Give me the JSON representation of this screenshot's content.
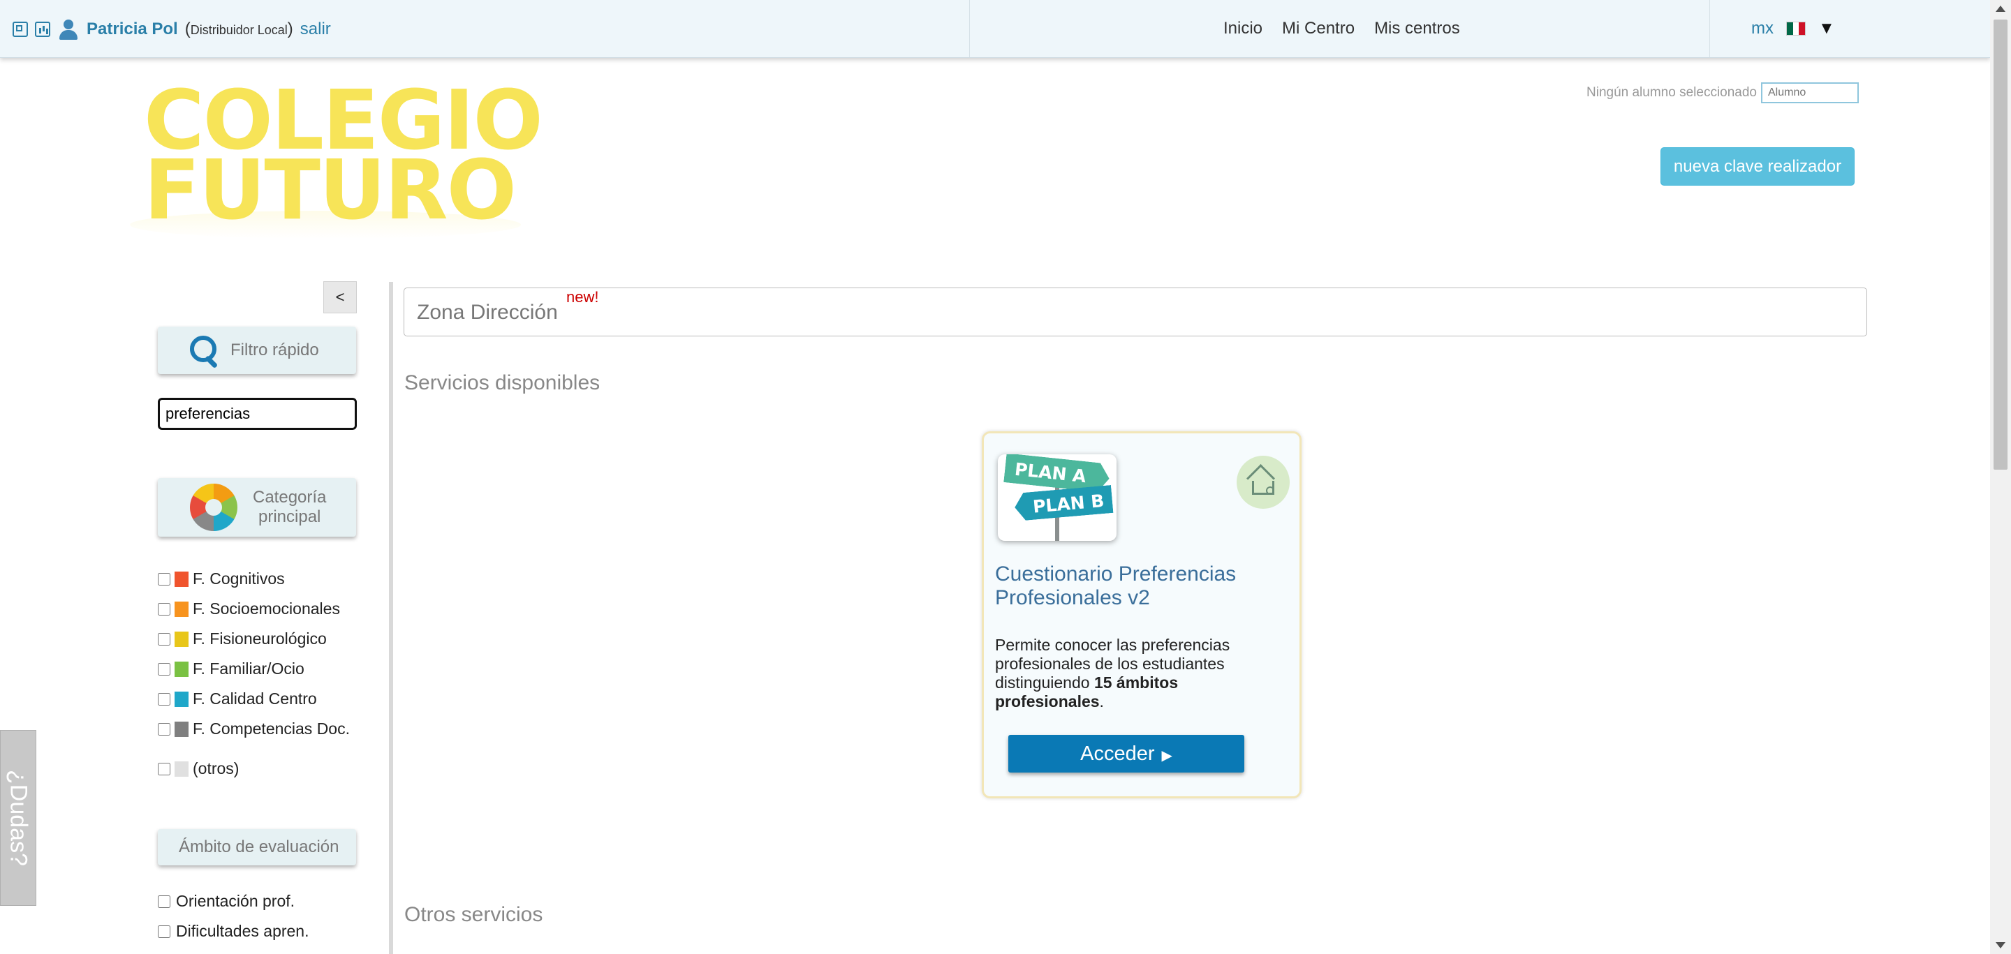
{
  "topbar": {
    "user_name": "Patricia Pol",
    "role_open": "(",
    "role": "Distribuidor Local",
    "role_close": ")",
    "logout": "salir",
    "nav": [
      "Inicio",
      "Mi Centro",
      "Mis centros"
    ],
    "lang_code": "mx",
    "flag": "mexico-flag-icon",
    "flag_colors": [
      "#006847",
      "#ffffff",
      "#ce1126"
    ]
  },
  "logo": {
    "line1": "COLEGIO",
    "line2": "FUTURO",
    "color": "#f7e24a"
  },
  "header": {
    "student_label": "Ningún alumno seleccionado",
    "student_placeholder": "Alumno",
    "new_key_button": "nueva clave realizador"
  },
  "sidebar": {
    "collapse_label": "<",
    "quick_filter": "Filtro rápido",
    "search_value": "preferencias",
    "category_line1": "Categoría",
    "category_line2": "principal",
    "categories": [
      {
        "label": "F. Cognitivos",
        "color": "#f0542d"
      },
      {
        "label": "F. Socioemocionales",
        "color": "#f7931e"
      },
      {
        "label": "F. Fisioneurológico",
        "color": "#e8c61a"
      },
      {
        "label": "F. Familiar/Ocio",
        "color": "#7ac143"
      },
      {
        "label": "F. Calidad Centro",
        "color": "#1fa7c9"
      },
      {
        "label": "F. Competencias Doc.",
        "color": "#7f7f7f"
      }
    ],
    "other_category": {
      "label": "(otros)",
      "color": "#e0e0e0"
    },
    "scope_button": "Ámbito de evaluación",
    "scopes": [
      "Orientación prof.",
      "Dificultades apren."
    ]
  },
  "help_tab": "¿Dudas?",
  "main": {
    "zone_title": "Zona Dirección",
    "zone_badge": "new!",
    "available_title": "Servicios disponibles",
    "other_title": "Otros servicios",
    "card": {
      "image_sign_a": "PLAN A",
      "image_sign_b": "PLAN B",
      "icon": "home-users-icon",
      "title": "Cuestionario Preferencias Profesionales v2",
      "desc_part1": "Permite conocer las preferencias profesionales de los estudiantes distinguiendo ",
      "desc_bold": "15 ámbitos profesionales",
      "desc_part2": ".",
      "button": "Acceder",
      "button_icon": "▶"
    }
  }
}
